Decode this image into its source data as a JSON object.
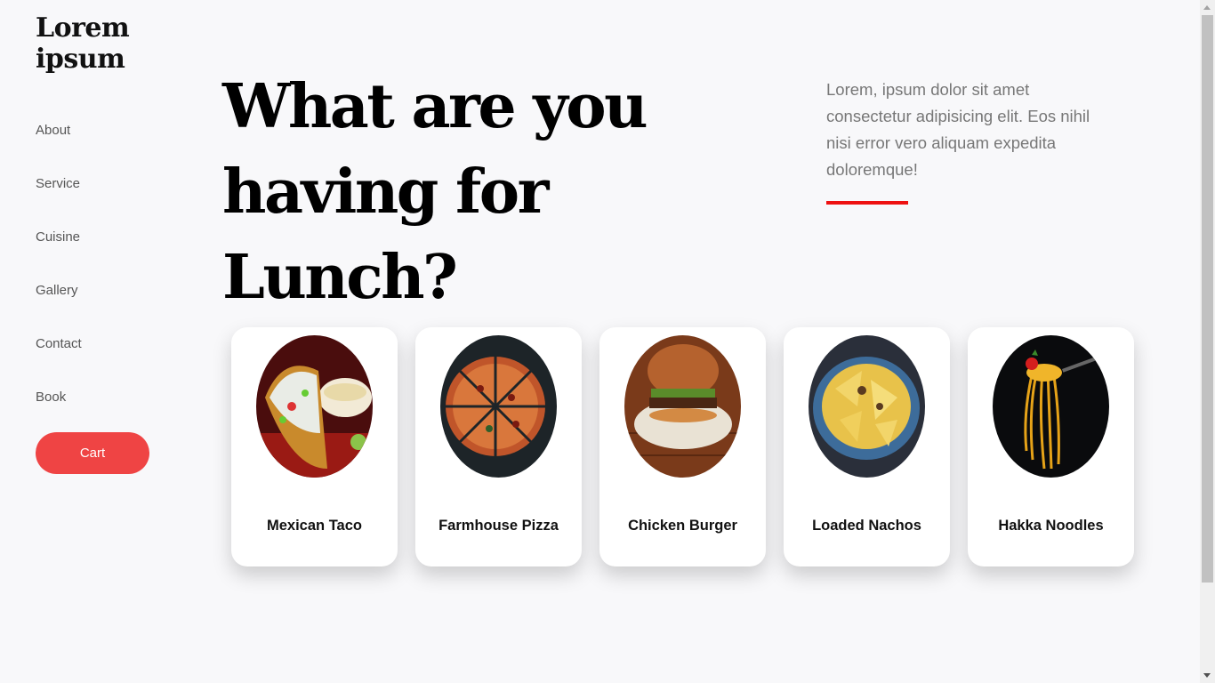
{
  "brand": {
    "name": "Lorem ipsum"
  },
  "nav": {
    "items": [
      "About",
      "Service",
      "Cuisine",
      "Gallery",
      "Contact",
      "Book"
    ],
    "cart_label": "Cart"
  },
  "hero": {
    "headline": "What are you having for Lunch?",
    "intro": "Lorem, ipsum dolor sit amet consectetur adipisicing elit. Eos nihil nisi error vero aliquam expedita doloremque!",
    "accent_color": "#ee1111"
  },
  "dishes": [
    {
      "name": "Mexican Taco",
      "icon": "taco-image"
    },
    {
      "name": "Farmhouse Pizza",
      "icon": "pizza-image"
    },
    {
      "name": "Chicken Burger",
      "icon": "burger-image"
    },
    {
      "name": "Loaded Nachos",
      "icon": "nachos-image"
    },
    {
      "name": "Hakka Noodles",
      "icon": "noodles-image"
    }
  ],
  "colors": {
    "cart_button": "#ef4444",
    "background": "#f8f8fa"
  }
}
